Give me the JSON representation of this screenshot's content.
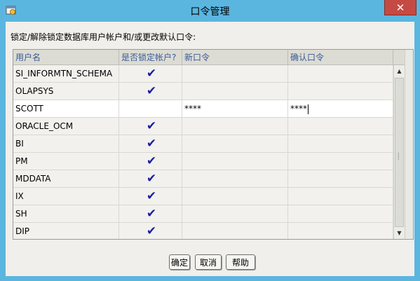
{
  "window": {
    "title": "口令管理",
    "close_label": "✕"
  },
  "instruction": "锁定/解除锁定数据库用户帐户和/或更改默认口令:",
  "table": {
    "columns": [
      "用户名",
      "是否锁定帐户?",
      "新口令",
      "确认口令"
    ],
    "rows": [
      {
        "user": "SI_INFORMTN_SCHEMA",
        "locked": true,
        "new_password": "",
        "confirm_password": ""
      },
      {
        "user": "OLAPSYS",
        "locked": true,
        "new_password": "",
        "confirm_password": ""
      },
      {
        "user": "SCOTT",
        "locked": false,
        "new_password": "****",
        "confirm_password": "****"
      },
      {
        "user": "ORACLE_OCM",
        "locked": true,
        "new_password": "",
        "confirm_password": ""
      },
      {
        "user": "BI",
        "locked": true,
        "new_password": "",
        "confirm_password": ""
      },
      {
        "user": "PM",
        "locked": true,
        "new_password": "",
        "confirm_password": ""
      },
      {
        "user": "MDDATA",
        "locked": true,
        "new_password": "",
        "confirm_password": ""
      },
      {
        "user": "IX",
        "locked": true,
        "new_password": "",
        "confirm_password": ""
      },
      {
        "user": "SH",
        "locked": true,
        "new_password": "",
        "confirm_password": ""
      },
      {
        "user": "DIP",
        "locked": true,
        "new_password": "",
        "confirm_password": ""
      }
    ],
    "check_glyph": "✔"
  },
  "buttons": {
    "ok": "确定",
    "cancel": "取消",
    "help": "帮助"
  },
  "colors": {
    "titlebar": "#5bb6df",
    "close": "#c54a43",
    "header_text": "#3a5a96",
    "checkmark": "#1d1d9e"
  },
  "icons": {
    "app": "app-window-icon",
    "close": "close-icon",
    "scroll_up": "scroll-up-arrow-icon",
    "scroll_down": "scroll-down-arrow-icon"
  }
}
